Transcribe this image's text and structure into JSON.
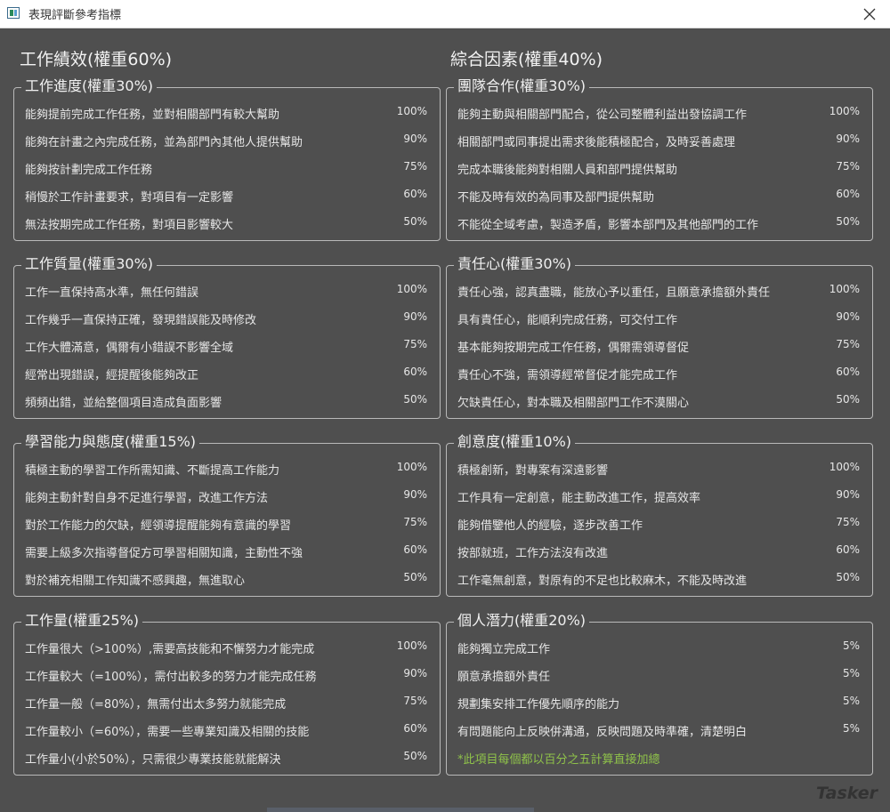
{
  "window": {
    "title": "表現評斷參考指標"
  },
  "columns": [
    {
      "title": "工作績效(權重60%)",
      "groups": [
        {
          "title": "工作進度(權重30%)",
          "items": [
            {
              "text": "能夠提前完成工作任務，並對相關部門有較大幫助",
              "pct": "100%"
            },
            {
              "text": "能夠在計畫之內完成任務，並為部門內其他人提供幫助",
              "pct": "90%"
            },
            {
              "text": "能夠按計劃完成工作任務",
              "pct": "75%"
            },
            {
              "text": "稍慢於工作計畫要求，對項目有一定影響",
              "pct": "60%"
            },
            {
              "text": "無法按期完成工作任務，對項目影響較大",
              "pct": "50%"
            }
          ]
        },
        {
          "title": "工作質量(權重30%)",
          "items": [
            {
              "text": "工作一直保持高水準，無任何錯誤",
              "pct": "100%"
            },
            {
              "text": "工作幾乎一直保持正確，發現錯誤能及時修改",
              "pct": "90%"
            },
            {
              "text": "工作大體滿意，偶爾有小錯誤不影響全域",
              "pct": "75%"
            },
            {
              "text": "經常出現錯誤，經提醒後能夠改正",
              "pct": "60%"
            },
            {
              "text": "頻頻出錯，並給整個項目造成負面影響",
              "pct": "50%"
            }
          ]
        },
        {
          "title": "學習能力與態度(權重15%)",
          "items": [
            {
              "text": "積極主動的學習工作所需知識、不斷提高工作能力",
              "pct": "100%"
            },
            {
              "text": "能夠主動針對自身不足進行學習，改進工作方法",
              "pct": "90%"
            },
            {
              "text": "對於工作能力的欠缺，經領導提醒能夠有意識的學習",
              "pct": "75%"
            },
            {
              "text": "需要上級多次指導督促方可學習相關知識，主動性不強",
              "pct": "60%"
            },
            {
              "text": "對於補充相關工作知識不感興趣，無進取心",
              "pct": "50%"
            }
          ]
        },
        {
          "title": "工作量(權重25%)",
          "items": [
            {
              "text": "工作量很大（>100%）,需要高技能和不懈努力才能完成",
              "pct": "100%"
            },
            {
              "text": "工作量較大（=100%），需付出較多的努力才能完成任務",
              "pct": "90%"
            },
            {
              "text": "工作量一般（=80%），無需付出太多努力就能完成",
              "pct": "75%"
            },
            {
              "text": "工作量較小（=60%），需要一些專業知識及相關的技能",
              "pct": "60%"
            },
            {
              "text": "工作量小(小於50%），只需很少專業技能就能解決",
              "pct": "50%"
            }
          ]
        }
      ]
    },
    {
      "title": "綜合因素(權重40%)",
      "groups": [
        {
          "title": "團隊合作(權重30%)",
          "items": [
            {
              "text": "能夠主動與相關部門配合，從公司整體利益出發協調工作",
              "pct": "100%"
            },
            {
              "text": "相關部門或同事提出需求後能積極配合，及時妥善處理",
              "pct": "90%"
            },
            {
              "text": "完成本職後能夠對相關人員和部門提供幫助",
              "pct": "75%"
            },
            {
              "text": "不能及時有效的為同事及部門提供幫助",
              "pct": "60%"
            },
            {
              "text": "不能從全域考慮，製造矛盾，影響本部門及其他部門的工作",
              "pct": "50%"
            }
          ]
        },
        {
          "title": "責任心(權重30%)",
          "items": [
            {
              "text": "責任心強，認真盡職，能放心予以重任，且願意承擔額外責任",
              "pct": "100%"
            },
            {
              "text": "具有責任心，能順利完成任務，可交付工作",
              "pct": "90%"
            },
            {
              "text": "基本能夠按期完成工作任務，偶爾需領導督促",
              "pct": "75%"
            },
            {
              "text": "責任心不強，需領導經常督促才能完成工作",
              "pct": "60%"
            },
            {
              "text": "欠缺責任心，對本職及相關部門工作不漠關心",
              "pct": "50%"
            }
          ]
        },
        {
          "title": "創意度(權重10%)",
          "items": [
            {
              "text": "積極創新，對專案有深遠影響",
              "pct": "100%"
            },
            {
              "text": "工作具有一定創意，能主動改進工作，提高效率",
              "pct": "90%"
            },
            {
              "text": "能夠借鑒他人的經驗，逐步改善工作",
              "pct": "75%"
            },
            {
              "text": "按部就班，工作方法沒有改進",
              "pct": "60%"
            },
            {
              "text": "工作毫無創意，對原有的不足也比較麻木，不能及時改進",
              "pct": "50%"
            }
          ]
        },
        {
          "title": "個人潛力(權重20%)",
          "items": [
            {
              "text": "能夠獨立完成工作",
              "pct": "5%"
            },
            {
              "text": "願意承擔額外責任",
              "pct": "5%"
            },
            {
              "text": "規劃集安排工作優先順序的能力",
              "pct": "5%"
            },
            {
              "text": "有問題能向上反映併溝通，反映問題及時準確，清楚明白",
              "pct": "5%"
            }
          ],
          "note": "*此項目每個都以百分之五計算直接加總"
        }
      ]
    }
  ],
  "watermark": "Tasker",
  "colors": {
    "background": "#4f4f4f",
    "text": "#e6e6e6",
    "border": "#b9b9b9",
    "note": "#8fc24a",
    "titlebar": "#ffffff"
  },
  "icons": {
    "close": "close-icon",
    "app": "app-window-icon"
  }
}
